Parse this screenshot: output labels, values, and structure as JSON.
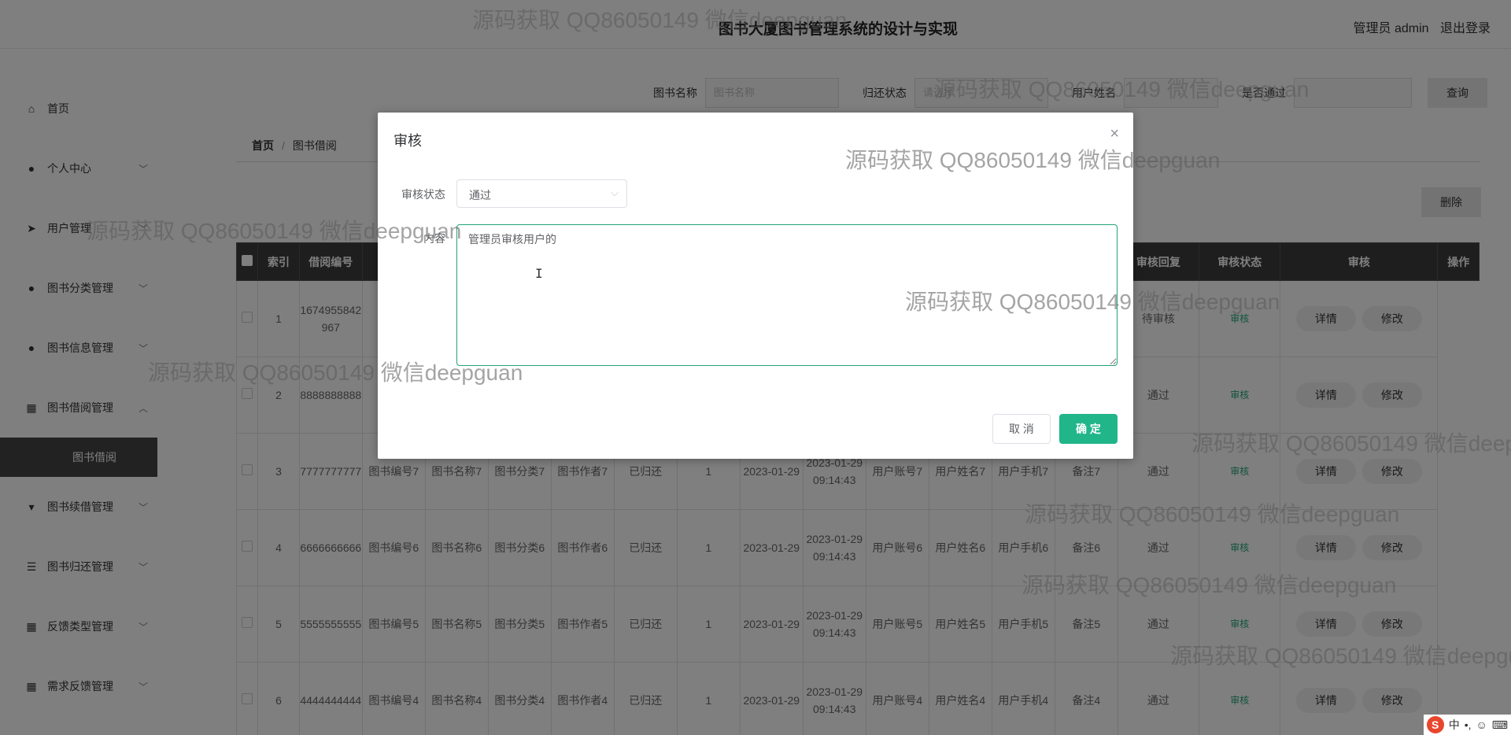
{
  "header": {
    "title": "图书大厦图书管理系统的设计与实现",
    "user_label": "管理员 admin",
    "logout_label": "退出登录"
  },
  "sidebar": {
    "items": [
      {
        "label": "首页",
        "icon": "home-icon",
        "has_chevron": false
      },
      {
        "label": "个人中心",
        "icon": "person-icon",
        "has_chevron": true
      },
      {
        "label": "用户管理",
        "icon": "send-icon",
        "has_chevron": true
      },
      {
        "label": "图书分类管理",
        "icon": "person-icon",
        "has_chevron": true
      },
      {
        "label": "图书信息管理",
        "icon": "person-icon",
        "has_chevron": true
      },
      {
        "label": "图书借阅管理",
        "icon": "grid-icon",
        "has_chevron": true,
        "expanded": true
      },
      {
        "label": "图书续借管理",
        "icon": "stamp-icon",
        "has_chevron": true
      },
      {
        "label": "图书归还管理",
        "icon": "sliders-icon",
        "has_chevron": true
      },
      {
        "label": "反馈类型管理",
        "icon": "grid-icon",
        "has_chevron": true
      },
      {
        "label": "需求反馈管理",
        "icon": "grid-icon",
        "has_chevron": true
      }
    ],
    "sub_item": "图书借阅"
  },
  "search": {
    "book_name_label": "图书名称",
    "book_name_placeholder": "图书名称",
    "return_status_label": "归还状态",
    "return_status_placeholder": "请选择",
    "user_name_label": "用户姓名",
    "audit_label": "是否通过",
    "query_button": "查询"
  },
  "breadcrumb": {
    "home": "首页",
    "separator": "/",
    "current": "图书借阅"
  },
  "toolbar": {
    "delete_label": "删除"
  },
  "table": {
    "headers": [
      "",
      "索引",
      "借阅编号",
      "",
      "",
      "",
      "",
      "",
      "",
      "",
      "",
      "",
      "",
      "",
      "",
      "审核回复",
      "审核状态",
      "审核",
      "操作"
    ],
    "rows": [
      {
        "index": "1",
        "code": "1674955842967",
        "status": "待审核",
        "audit": "审核",
        "detail": "详情",
        "edit": "修改"
      },
      {
        "index": "2",
        "code": "8888888888",
        "status": "通过",
        "audit": "审核",
        "detail": "详情",
        "edit": "修改"
      },
      {
        "index": "3",
        "code": "7777777777",
        "book_no": "图书编号7",
        "book_name": "图书名称7",
        "category": "图书分类7",
        "author": "图书作者7",
        "return": "已归还",
        "qty": "1",
        "borrow_date": "2023-01-29",
        "due_date": "2023-01-29 09:14:43",
        "account": "用户账号7",
        "user_name": "用户姓名7",
        "phone": "用户手机7",
        "remark": "备注7",
        "status": "通过",
        "audit": "审核",
        "detail": "详情",
        "edit": "修改"
      },
      {
        "index": "4",
        "code": "6666666666",
        "book_no": "图书编号6",
        "book_name": "图书名称6",
        "category": "图书分类6",
        "author": "图书作者6",
        "return": "已归还",
        "qty": "1",
        "borrow_date": "2023-01-29",
        "due_date": "2023-01-29 09:14:43",
        "account": "用户账号6",
        "user_name": "用户姓名6",
        "phone": "用户手机6",
        "remark": "备注6",
        "status": "通过",
        "audit": "审核",
        "detail": "详情",
        "edit": "修改"
      },
      {
        "index": "5",
        "code": "5555555555",
        "book_no": "图书编号5",
        "book_name": "图书名称5",
        "category": "图书分类5",
        "author": "图书作者5",
        "return": "已归还",
        "qty": "1",
        "borrow_date": "2023-01-29",
        "due_date": "2023-01-29 09:14:43",
        "account": "用户账号5",
        "user_name": "用户姓名5",
        "phone": "用户手机5",
        "remark": "备注5",
        "status": "通过",
        "audit": "审核",
        "detail": "详情",
        "edit": "修改"
      },
      {
        "index": "6",
        "code": "4444444444",
        "book_no": "图书编号4",
        "book_name": "图书名称4",
        "category": "图书分类4",
        "author": "图书作者4",
        "return": "已归还",
        "qty": "1",
        "borrow_date": "2023-01-29",
        "due_date": "2023-01-29 09:14:43",
        "account": "用户账号4",
        "user_name": "用户姓名4",
        "phone": "用户手机4",
        "remark": "备注4",
        "status": "通过",
        "audit": "审核",
        "detail": "详情",
        "edit": "修改"
      }
    ]
  },
  "dialog": {
    "title": "审核",
    "status_label": "审核状态",
    "status_value": "通过",
    "content_label": "内容",
    "content_value": "管理员审核用户的",
    "cancel_label": "取 消",
    "confirm_label": "确 定",
    "accent_color": "#21b58a"
  },
  "watermark": {
    "text": "源码获取 QQ86050149 微信deepguan"
  },
  "ime": {
    "logo": "S",
    "mode": "中"
  }
}
